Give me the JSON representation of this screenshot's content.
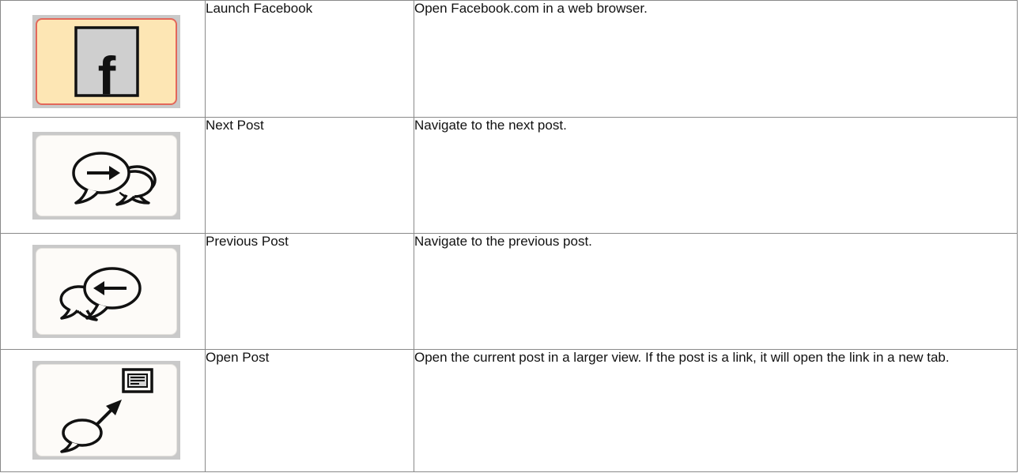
{
  "commands": [
    {
      "icon": "facebook-logo-icon",
      "name": "Launch Facebook",
      "description": "Open Facebook.com in a web browser."
    },
    {
      "icon": "next-post-speech-bubbles-icon",
      "name": "Next Post",
      "description": "Navigate to the next post."
    },
    {
      "icon": "previous-post-speech-bubbles-icon",
      "name": "Previous Post",
      "description": "Navigate to the previous post."
    },
    {
      "icon": "open-post-icon",
      "name": "Open Post",
      "description": "Open the current post in a larger view. If the post is a link, it will open the link in a new tab."
    }
  ],
  "colors": {
    "active_button_fill": "#fde6b4",
    "active_button_border": "#e3675a",
    "button_fill": "#fdfbf8",
    "button_frame": "#c9c9c9",
    "table_border": "#8a8a8a"
  }
}
